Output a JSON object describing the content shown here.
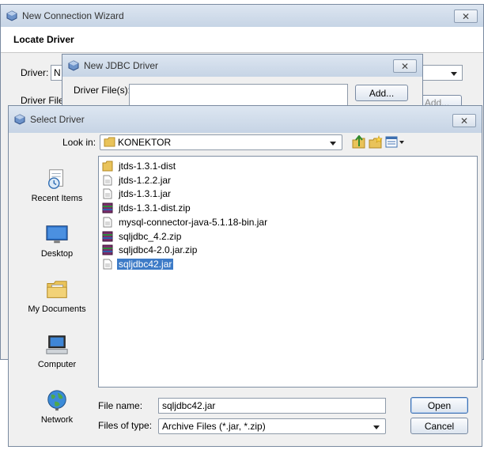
{
  "wizard": {
    "title": "New Connection Wizard",
    "close_glyph": "✕",
    "section_heading": "Locate Driver",
    "driver_label": "Driver:",
    "driver_value": "N",
    "driver_file_label": "Driver File",
    "add_label_partial": "Add..."
  },
  "jdbc": {
    "title": "New JDBC Driver",
    "close_glyph": "✕",
    "driver_files_label": "Driver File(s):",
    "add_label": "Add..."
  },
  "select": {
    "title": "Select Driver",
    "close_glyph": "✕",
    "look_in_label": "Look in:",
    "look_in_value": "KONEKTOR",
    "places": [
      {
        "label": "Recent Items",
        "icon": "recent-items-icon"
      },
      {
        "label": "Desktop",
        "icon": "desktop-icon"
      },
      {
        "label": "My Documents",
        "icon": "my-documents-icon"
      },
      {
        "label": "Computer",
        "icon": "computer-icon"
      },
      {
        "label": "Network",
        "icon": "network-icon"
      }
    ],
    "files": [
      {
        "name": "jtds-1.3.1-dist",
        "type": "folder"
      },
      {
        "name": "jtds-1.2.2.jar",
        "type": "jar"
      },
      {
        "name": "jtds-1.3.1.jar",
        "type": "jar"
      },
      {
        "name": "jtds-1.3.1-dist.zip",
        "type": "zip"
      },
      {
        "name": "mysql-connector-java-5.1.18-bin.jar",
        "type": "jar"
      },
      {
        "name": "sqljdbc_4.2.zip",
        "type": "zip"
      },
      {
        "name": "sqljdbc4-2.0.jar.zip",
        "type": "zip"
      },
      {
        "name": "sqljdbc42.jar",
        "type": "jar",
        "selected": true
      }
    ],
    "file_name_label": "File name:",
    "file_name_value": "sqljdbc42.jar",
    "files_of_type_label": "Files of type:",
    "files_of_type_value": "Archive Files (*.jar, *.zip)",
    "open_label": "Open",
    "cancel_label": "Cancel"
  },
  "colors": {
    "dialog_bg": "#f0f0f0",
    "title_gradient_top": "#dde6f1",
    "selection": "#3d7bc7"
  }
}
